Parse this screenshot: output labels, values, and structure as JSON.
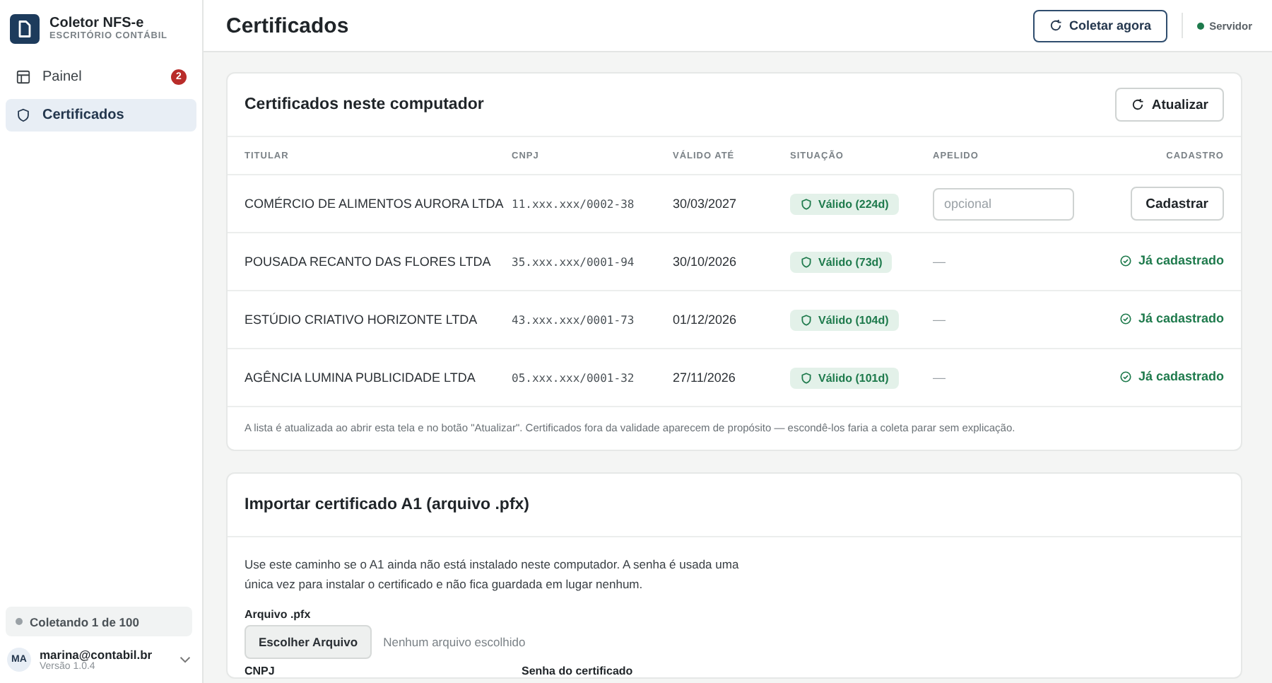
{
  "app": {
    "name": "Coletor NFS-e",
    "subtitle": "ESCRITÓRIO CONTÁBIL"
  },
  "nav": [
    {
      "label": "Painel",
      "badge": "2",
      "selected": false
    },
    {
      "label": "Certificados",
      "selected": true
    }
  ],
  "collect_status": {
    "text": "Coletando 1 de 100"
  },
  "user": {
    "initials": "MA",
    "email": "marina@contabil.br",
    "version": "Versão 1.0.4"
  },
  "header": {
    "title": "Certificados",
    "action": "Coletar agora",
    "server": {
      "label": "Servidor",
      "online": true
    }
  },
  "certs_card": {
    "title": "Certificados neste computador",
    "refresh": "Atualizar",
    "columns": [
      "TITULAR",
      "CNPJ",
      "VÁLIDO ATÉ",
      "SITUAÇÃO",
      "APELIDO",
      "CADASTRO"
    ],
    "rows": [
      {
        "holder": "COMÉRCIO DE ALIMENTOS AURORA LTDA",
        "cnpj": "11.xxx.xxx/0002-38",
        "valid_until": "30/03/2027",
        "status": {
          "kind": "valid",
          "label": "Válido (224d)"
        },
        "nickname": {
          "kind": "input",
          "placeholder": "opcional"
        },
        "registration": {
          "kind": "button",
          "label": "Cadastrar"
        }
      },
      {
        "holder": "POUSADA RECANTO DAS FLORES LTDA",
        "cnpj": "35.xxx.xxx/0001-94",
        "valid_until": "30/10/2026",
        "status": {
          "kind": "valid",
          "label": "Válido (73d)"
        },
        "nickname": {
          "kind": "text",
          "text": "—"
        },
        "registration": {
          "kind": "done",
          "label": "Já cadastrado"
        }
      },
      {
        "holder": "ESTÚDIO CRIATIVO HORIZONTE LTDA",
        "cnpj": "43.xxx.xxx/0001-73",
        "valid_until": "01/12/2026",
        "status": {
          "kind": "valid",
          "label": "Válido (104d)"
        },
        "nickname": {
          "kind": "text",
          "text": "—"
        },
        "registration": {
          "kind": "done",
          "label": "Já cadastrado"
        }
      },
      {
        "holder": "AGÊNCIA LUMINA PUBLICIDADE LTDA",
        "cnpj": "05.xxx.xxx/0001-32",
        "valid_until": "27/11/2026",
        "status": {
          "kind": "valid",
          "label": "Válido (101d)"
        },
        "nickname": {
          "kind": "text",
          "text": "—"
        },
        "registration": {
          "kind": "done",
          "label": "Já cadastrado"
        }
      }
    ],
    "note": "A lista é atualizada ao abrir esta tela e no botão \"Atualizar\". Certificados fora da validade aparecem de propósito — escondê-los faria a coleta parar sem explicação."
  },
  "import_card": {
    "title": "Importar certificado A1 (arquivo .pfx)",
    "description": "Use este caminho se o A1 ainda não está instalado neste computador. A senha é usada uma única vez para instalar o certificado e não fica guardada em lugar nenhum.",
    "file_label": "Arquivo .pfx",
    "file_button": "Escolher Arquivo",
    "file_status": "Nenhum arquivo escolhido",
    "field_labels": [
      "CNPJ",
      "Senha do certificado"
    ]
  }
}
